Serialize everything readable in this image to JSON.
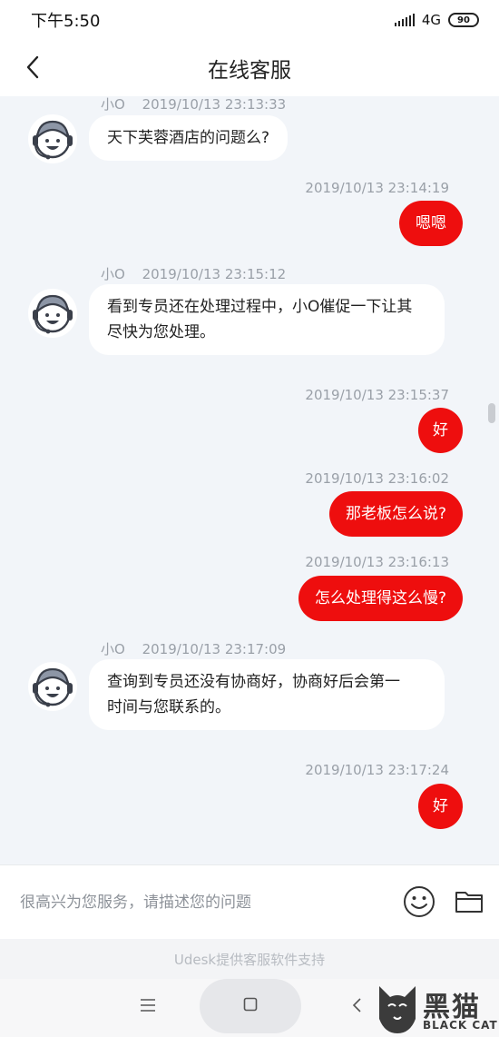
{
  "status_bar": {
    "time": "下午5:50",
    "network": "4G",
    "battery": "90"
  },
  "header": {
    "title": "在线客服"
  },
  "messages": [
    {
      "type": "agent",
      "sender": "小O",
      "time": "2019/10/13 23:13:33",
      "text": "天下芙蓉酒店的问题么?"
    },
    {
      "type": "user",
      "time": "2019/10/13 23:14:19",
      "text": "嗯嗯"
    },
    {
      "type": "agent",
      "sender": "小O",
      "time": "2019/10/13 23:15:12",
      "lines": [
        "看到专员还在处理过程中，小O催促一下让其",
        "尽快为您处理。"
      ]
    },
    {
      "type": "user",
      "time": "2019/10/13 23:15:37",
      "text": "好"
    },
    {
      "type": "user",
      "time": "2019/10/13 23:16:02",
      "text": "那老板怎么说?"
    },
    {
      "type": "user",
      "time": "2019/10/13 23:16:13",
      "text": "怎么处理得这么慢?"
    },
    {
      "type": "agent",
      "sender": "小O",
      "time": "2019/10/13 23:17:09",
      "lines": [
        "查询到专员还没有协商好，协商好后会第一",
        "时间与您联系的。"
      ]
    },
    {
      "type": "user",
      "time": "2019/10/13 23:17:24",
      "text": "好"
    }
  ],
  "input": {
    "placeholder": "很高兴为您服务，请描述您的问题"
  },
  "footer": {
    "note": "Udesk提供客服软件支持"
  },
  "watermark": {
    "title": "黑猫",
    "subtitle": "BLACK CAT"
  },
  "icons": {
    "back": "chevron-left-icon",
    "emoji": "smiley-icon",
    "file": "folder-icon",
    "menu": "menu-icon",
    "home": "square-icon",
    "nav_back": "triangle-left-icon",
    "avatar": "headset-agent-icon"
  },
  "colors": {
    "accent": "#ee0e0e",
    "chat_bg": "#f2f5f9"
  }
}
